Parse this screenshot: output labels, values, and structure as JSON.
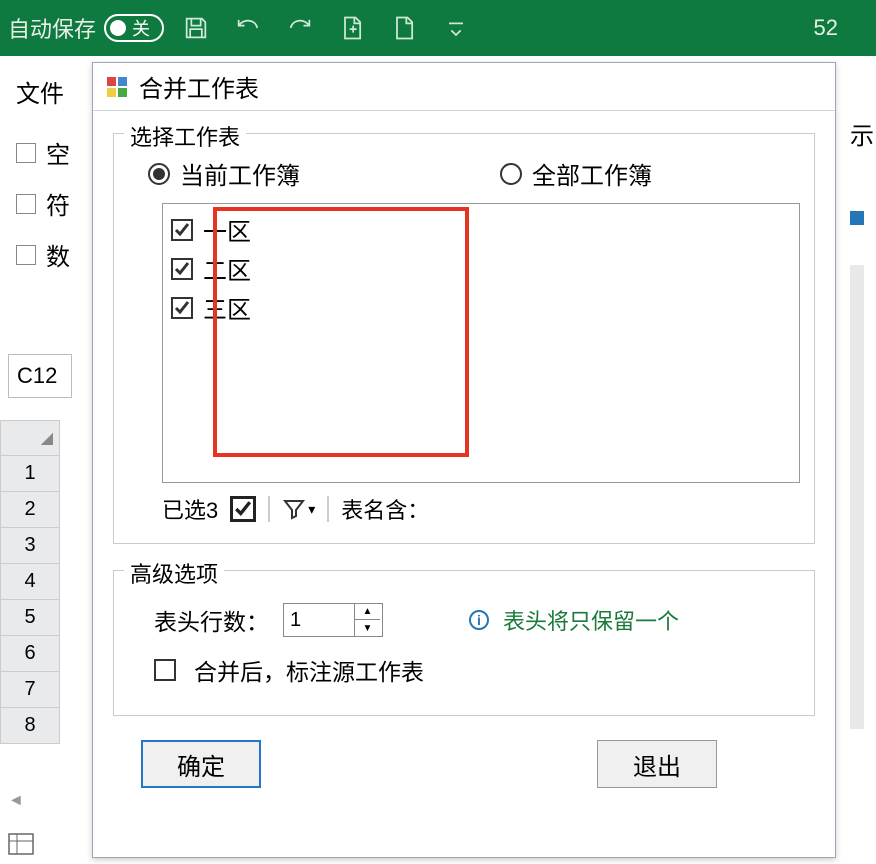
{
  "ribbon": {
    "autosave_label": "自动保存",
    "autosave_state": "关",
    "right_number": "52"
  },
  "left": {
    "file_tab": "文件",
    "filters": [
      "空",
      "符",
      "数"
    ]
  },
  "cell_ref": "C12",
  "row_numbers": [
    "1",
    "2",
    "3",
    "4",
    "5",
    "6",
    "7",
    "8"
  ],
  "right_strip_label": "示",
  "dialog": {
    "title": "合并工作表",
    "group_select": {
      "legend": "选择工作表",
      "radio_current": "当前工作簿",
      "radio_all": "全部工作簿",
      "sheets": [
        "一区",
        "二区",
        "三区"
      ],
      "selected_count_label": "已选3",
      "name_contains_label": "表名含："
    },
    "group_adv": {
      "legend": "高级选项",
      "header_rows_label": "表头行数：",
      "header_rows_value": "1",
      "info_text": "表头将只保留一个",
      "mark_source_label": "合并后，标注源工作表"
    },
    "buttons": {
      "ok": "确定",
      "exit": "退出"
    }
  }
}
